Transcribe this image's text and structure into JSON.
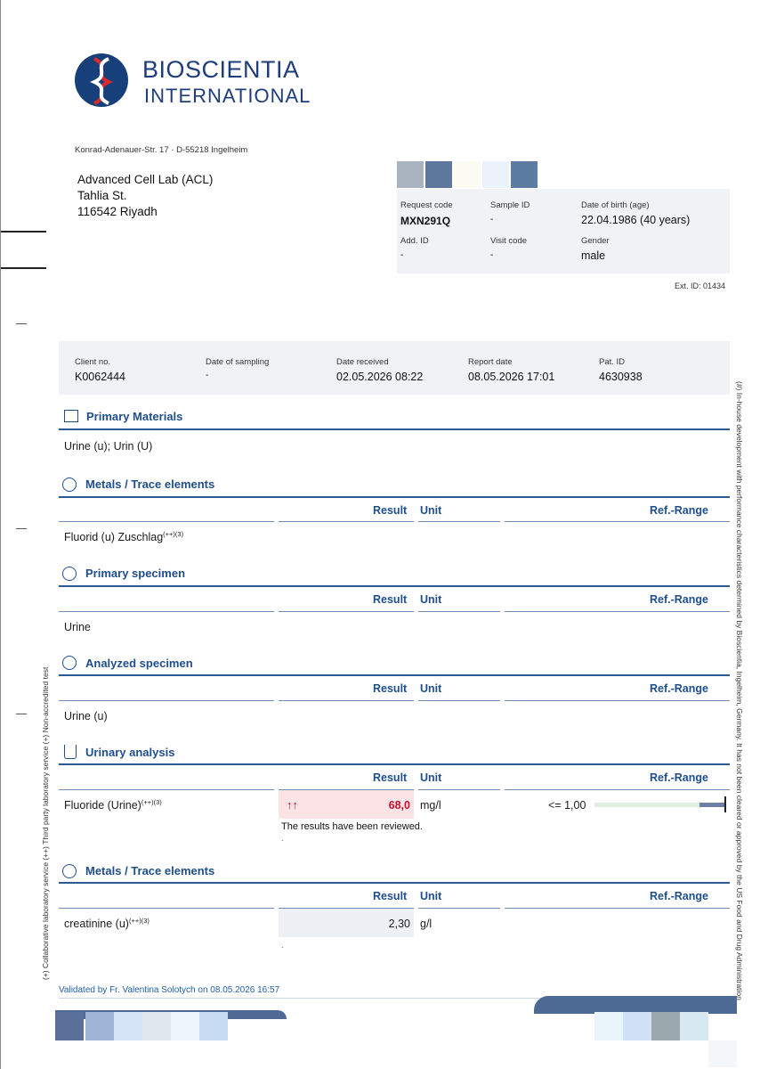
{
  "logo": {
    "line1": "BIOSCIENTIA",
    "line2": "INTERNATIONAL"
  },
  "sender_line": "Konrad-Adenauer-Str. 17 · D-55218 Ingelheim",
  "recipient": {
    "line1": "Advanced Cell Lab (ACL)",
    "line2": "Tahlia St.",
    "line3": "116542 Riyadh"
  },
  "request": {
    "request_code_label": "Request code",
    "request_code": "MXN291Q",
    "sample_id_label": "Sample ID",
    "sample_id": "-",
    "dob_label": "Date of birth (age)",
    "dob": "22.04.1986 (40 years)",
    "add_id_label": "Add. ID",
    "add_id": "-",
    "visit_code_label": "Visit code",
    "visit_code": "-",
    "gender_label": "Gender",
    "gender": "male"
  },
  "ext_id": "Ext. ID: 01434",
  "client": {
    "client_no_label": "Client no.",
    "client_no": "K0062444",
    "sampling_label": "Date of sampling",
    "sampling": "-",
    "received_label": "Date received",
    "received": "02.05.2026 08:22",
    "report_label": "Report date",
    "report": "08.05.2026 17:01",
    "pat_label": "Pat. ID",
    "pat": "4630938"
  },
  "columns": {
    "result": "Result",
    "unit": "Unit",
    "ref": "Ref.-Range"
  },
  "sections": {
    "primary_materials": {
      "title": "Primary Materials",
      "text": "Urine (u); Urin (U)"
    },
    "metals1": {
      "title": "Metals / Trace elements",
      "row": "Fluorid (u)  Zuschlag",
      "sup": "(++)(3)"
    },
    "primary_specimen": {
      "title": "Primary specimen",
      "row": "Urine"
    },
    "analyzed_specimen": {
      "title": "Analyzed specimen",
      "row": "Urine (u)"
    },
    "urinary": {
      "title": "Urinary analysis",
      "row": "Fluoride (Urine)",
      "sup": "(++)(3)",
      "flag": "↑↑",
      "result": "68,0",
      "unit": "mg/l",
      "ref": "<= 1,00",
      "note": "The results have been reviewed.",
      "dot": "."
    },
    "metals2": {
      "title": "Metals / Trace elements",
      "row": "creatinine (u)",
      "sup": "(++)(3)",
      "result": "2,30",
      "unit": "g/l",
      "dot": "."
    }
  },
  "validated": "Validated by Fr. Valentina Solotych on 08.05.2026 16:57",
  "side_left": "(+) Collaborative laboratory service (++) Third party laboratory service (+) Non-accredited test",
  "side_right": "(#) In-house development with performance characteristics determined by Bioscientia, Ingelheim, Germany. It has not been cleared or approved by the US Food and Drug Administration",
  "colors": {
    "accent": "#1f4e8c",
    "flag_red": "#c8102e",
    "highlight": "#fbe3e6"
  }
}
